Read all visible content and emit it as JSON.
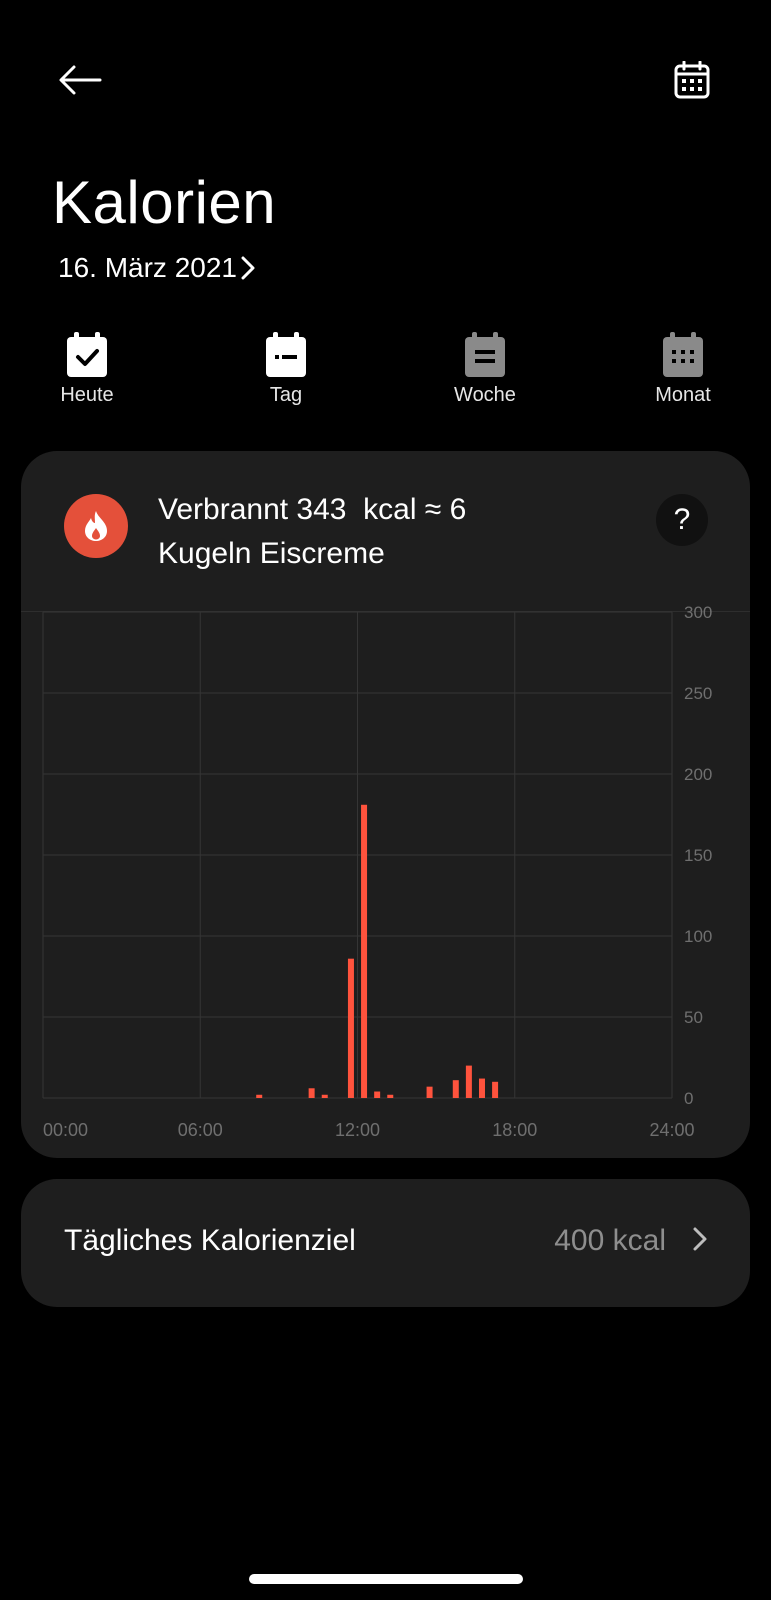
{
  "header": {
    "title": "Kalorien",
    "date": "16. März 2021",
    "back_icon": "arrow-left-icon",
    "calendar_icon": "calendar-icon"
  },
  "periods": [
    {
      "label": "Heute",
      "icon": "calendar-check-icon"
    },
    {
      "label": "Tag",
      "icon": "calendar-day-icon"
    },
    {
      "label": "Woche",
      "icon": "calendar-week-icon"
    },
    {
      "label": "Monat",
      "icon": "calendar-month-icon"
    }
  ],
  "summary": {
    "line1": "Verbrannt 343  kcal ≈ 6",
    "line2": "Kugeln Eiscreme",
    "help": "?",
    "icon": "flame-icon"
  },
  "chart_data": {
    "type": "bar",
    "x_label_ticks": [
      "00:00",
      "06:00",
      "12:00",
      "18:00",
      "24:00"
    ],
    "xlim": [
      0,
      24
    ],
    "ylim": [
      0,
      300
    ],
    "y_ticks": [
      0,
      50,
      100,
      150,
      200,
      250,
      300
    ],
    "y_axis_position": "right",
    "grid": true,
    "x": [
      8.25,
      10.25,
      10.75,
      11.75,
      12.25,
      12.75,
      13.25,
      14.75,
      15.75,
      16.25,
      16.75,
      17.25
    ],
    "values": [
      2,
      6,
      2,
      86,
      181,
      4,
      2,
      7,
      11,
      20,
      12,
      10
    ],
    "bar_color": "#ff533d"
  },
  "goal": {
    "label": "Tägliches Kalorienziel",
    "value": "400 kcal",
    "icon": "chevron-right-icon"
  },
  "colors": {
    "background": "#000000",
    "card": "#1e1e1e",
    "accent": "#ff533d",
    "flame_circle": "#e4503a"
  }
}
